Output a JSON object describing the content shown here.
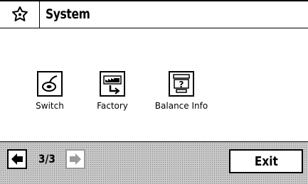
{
  "header": {
    "title": "System",
    "icon": "puzzle-star-icon"
  },
  "apps": [
    {
      "label": "Switch",
      "icon": "switch-icon"
    },
    {
      "label": "Factory",
      "icon": "factory-icon"
    },
    {
      "label": "Balance Info",
      "icon": "balance-info-icon"
    }
  ],
  "footer": {
    "page_indicator": "3/3",
    "exit_label": "Exit",
    "prev_icon": "arrow-left-icon",
    "next_icon": "arrow-right-icon"
  }
}
